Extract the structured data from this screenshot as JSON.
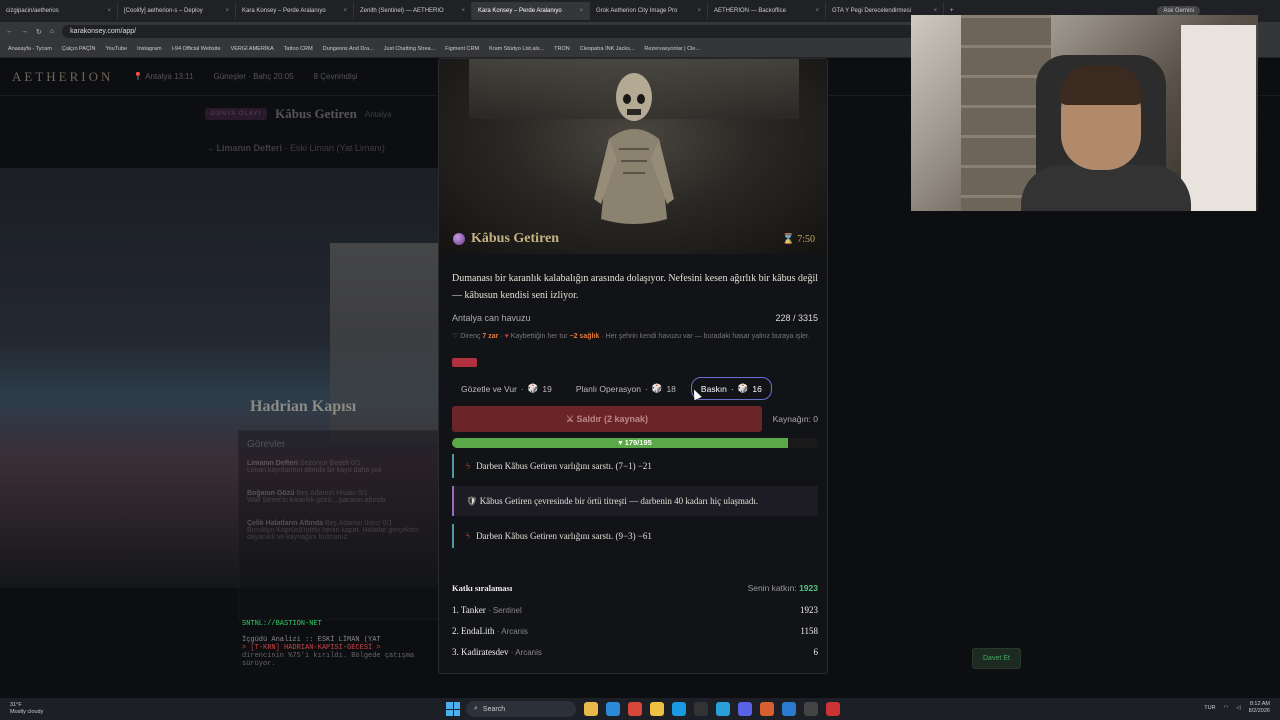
{
  "browser": {
    "tabs": [
      {
        "label": "cizgipacin/aetherios"
      },
      {
        "label": "[Coolify] aetherion-s – Deploy"
      },
      {
        "label": "Kara Konsey – Perde Aralanıyo"
      },
      {
        "label": "Zenith (Sentinel) — AETHERIO"
      },
      {
        "label": "Kara Konsey – Perde Aralanıyo"
      },
      {
        "label": "Grok Aetherion City Image Pro"
      },
      {
        "label": "AETHERION — Backoffice"
      },
      {
        "label": "GTA Y Pegi Derecelendirmesi"
      }
    ],
    "profile": "Ask Gemini",
    "url": "karakonsey.com/app/",
    "bookmarks": [
      "Anasayfa - Tycam",
      "Çalçın PAÇİN",
      "YouTube",
      "Instagram",
      "I-94 Official Website",
      "VERGİ AMERİKA",
      "Tattoo CRM",
      "Dungeons And Dra...",
      "Just Chatting Strea...",
      "Figment CRM",
      "Kram Stüdyo List.als...",
      "TRON",
      "Cleopatra INK Jacks...",
      "Rezervasyonlar | Cle..."
    ]
  },
  "app": {
    "logo": "AETHERION",
    "city": "Antalya",
    "time": "13:11",
    "weather": "Güneşler · Bahç 20:05",
    "online": "8 Çevrimdişi",
    "event_badge": "DÜNYA OLAYI",
    "event_title": "Kâbus Getiren",
    "event_city": "Antalya",
    "ledger": "Limanın Defteri",
    "ledger_loc": "Eski Liman (Yat Limanı)",
    "location_title": "Hadrian Kapısı",
    "tasks_title": "Görevler",
    "tasks": [
      {
        "name": "Limanın Defteri",
        "tag": "Sezonun Bedeli",
        "count": "0/1",
        "text": "Liman kayıtlarının altında bir kayıt daha yok"
      },
      {
        "name": "Boğanın Gözü",
        "tag": "Beş Adamın Hisabı",
        "count": "0/1",
        "text": "Wall Street'in karanlık gözü... paranın altında"
      },
      {
        "name": "Çelik Halatların Altında",
        "tag": "Beş Adamın İkinci",
        "count": "0/1",
        "text": "Brooklyn Köprüsü'ndeki tamiri kapat. Halatlar gerçekten dayanıklı ve kaynağını bulmanız"
      }
    ],
    "terminal": [
      "SNTNL://BASTION-NET",
      "İçgüdü Analizi :: ESKİ LİMAN (YAT",
      "> [T-KRN] HADRIAN-KAPISI-GECESİ >",
      "direncinin %75'i kırıldı. Bölgede çatışma sürüyor."
    ],
    "invite": "Davet Et"
  },
  "modal": {
    "boss_name": "Kâbus Getiren",
    "timer": "7:50",
    "description": "Dumanası bir karanlık kalabalığın arasında dolaşıyor. Nefesini kesen ağırlık bir kâbus değil — kâbusun kendisi seni izliyor.",
    "pool_label": "Antalya can havuzu",
    "pool_value": "228 / 3315",
    "pool_fraction": 0.0688,
    "resist_label": "Direnç",
    "resist_value": "7 zar",
    "loss_text": "Kaybettiğin her tur",
    "loss_value": "−2 sağlık",
    "pool_note": "· Her şehrin kendi havuzu var — buradaki hasar yalnız buraya işler.",
    "modes": [
      {
        "label": "Gözetle ve Vur",
        "dice": "19"
      },
      {
        "label": "Planlı Operasyon",
        "dice": "18"
      },
      {
        "label": "Baskın",
        "dice": "16"
      }
    ],
    "attack_label": "⚔ Saldır (2 kaynak)",
    "resource_label": "Kaynağın: 0",
    "hp_text": "179/195",
    "hp_fraction": 0.918,
    "log": [
      {
        "text": "Darben Kâbus Getiren varlığını sarstı. (7−1) −21"
      },
      {
        "text": "Kâbus Getiren çevresinde bir örtü titreşti — darbenin 40 kadarı hiç ulaşmadı."
      },
      {
        "text": "Darben Kâbus Getiren varlığını sarstı. (9−3) −61"
      }
    ],
    "contrib_title": "Katkı sıralaması",
    "my_contrib_label": "Senin katkın:",
    "my_contrib_value": "1923",
    "ranking": [
      {
        "rank": "1.",
        "name": "Tanker",
        "cls": "Sentinel",
        "score": "1923"
      },
      {
        "rank": "2.",
        "name": "EndaLith",
        "cls": "Arcanis",
        "score": "1158"
      },
      {
        "rank": "3.",
        "name": "Kadiratesdev",
        "cls": "Arcanis",
        "score": "6"
      }
    ]
  },
  "taskbar": {
    "weather_temp": "31°F",
    "weather_desc": "Mostly cloudy",
    "search_label": "Search",
    "lang": "TUR",
    "time": "8:12 AM",
    "date": "8/2/2026"
  }
}
